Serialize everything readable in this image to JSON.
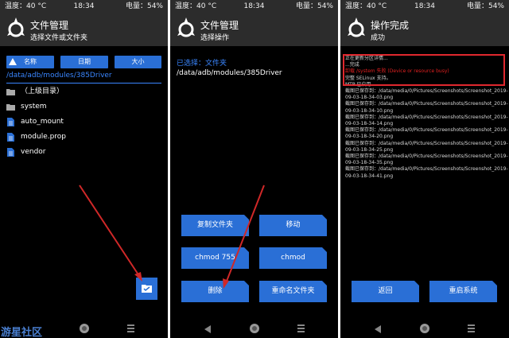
{
  "colors": {
    "accent": "#2a6fd6",
    "link": "#3a86ff",
    "error": "#e02020",
    "annotation": "#e0282e",
    "header_bg": "#2c2c2c"
  },
  "panels": [
    {
      "status": {
        "temp": "温度：40 °C",
        "time": "18:34",
        "battery": "电量：54%"
      },
      "header": {
        "title": "文件管理",
        "subtitle": "选择文件或文件夹"
      },
      "sort": {
        "name": "名称",
        "date": "日期",
        "size": "大小"
      },
      "path": "/data/adb/modules/385Driver",
      "files": [
        {
          "name": "（上级目录）",
          "icon": "folder-icon"
        },
        {
          "name": "system",
          "icon": "folder-icon"
        },
        {
          "name": "auto_mount",
          "icon": "file-icon"
        },
        {
          "name": "module.prop",
          "icon": "file-icon"
        },
        {
          "name": "vendor",
          "icon": "file-icon"
        }
      ],
      "fab_icon": "folder-select-icon"
    },
    {
      "status": {
        "temp": "温度：40 °C",
        "time": "18:34",
        "battery": "电量：54%"
      },
      "header": {
        "title": "文件管理",
        "subtitle": "选择操作"
      },
      "selected_label": "已选择：文件夹",
      "selected_path": "/data/adb/modules/385Driver",
      "buttons": {
        "copy": "复制文件夹",
        "move": "移动",
        "chmod755": "chmod 755",
        "chmod": "chmod",
        "delete": "删除",
        "rename": "重命名文件夹"
      }
    },
    {
      "status": {
        "temp": "温度：40 °C",
        "time": "18:34",
        "battery": "电量：54%"
      },
      "header": {
        "title": "操作完成",
        "subtitle": "成功"
      },
      "log": {
        "line1": "正在更新分区详情...",
        "line2": "...完成",
        "error": "卸载 /system 失败 (Device or resource busy)",
        "line3": "完整 SELinux 支持。",
        "line4": "MTP 已启用",
        "shots": [
          "截图已保存到：/data/media/0/Pictures/Screenshots/Screenshot_2019-",
          "09-03-18-34-03.png",
          "截图已保存到：/data/media/0/Pictures/Screenshots/Screenshot_2019-",
          "09-03-18-34-10.png",
          "截图已保存到：/data/media/0/Pictures/Screenshots/Screenshot_2019-",
          "09-03-18-34-14.png",
          "截图已保存到：/data/media/0/Pictures/Screenshots/Screenshot_2019-",
          "09-03-18-34-20.png",
          "截图已保存到：/data/media/0/Pictures/Screenshots/Screenshot_2019-",
          "09-03-18-34-25.png",
          "截图已保存到：/data/media/0/Pictures/Screenshots/Screenshot_2019-",
          "09-03-18-34-35.png",
          "截图已保存到：/data/media/0/Pictures/Screenshots/Screenshot_2019-",
          "09-03-18-34-41.png"
        ]
      },
      "buttons": {
        "back": "返回",
        "reboot": "重启系统"
      }
    }
  ],
  "watermark": "游星社区"
}
